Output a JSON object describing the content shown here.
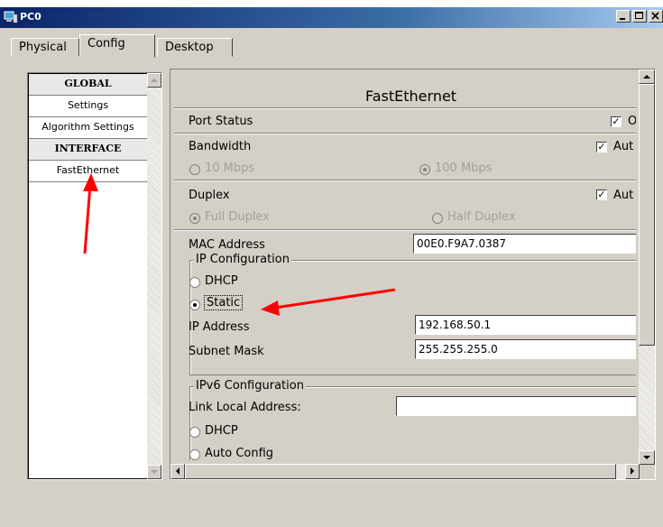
{
  "window": {
    "title": "PC0"
  },
  "tabs": [
    {
      "label": "Physical"
    },
    {
      "label": "Config"
    },
    {
      "label": "Desktop"
    }
  ],
  "sidebar": {
    "items": [
      {
        "label": "GLOBAL",
        "header": true
      },
      {
        "label": "Settings"
      },
      {
        "label": "Algorithm Settings"
      },
      {
        "label": "INTERFACE",
        "header": true
      },
      {
        "label": "FastEthernet"
      }
    ]
  },
  "panel": {
    "title": "FastEthernet",
    "port_status_label": "Port Status",
    "port_status_check_label": "O",
    "bandwidth_label": "Bandwidth",
    "bandwidth_auto_label": "Aut",
    "bw_10": "10 Mbps",
    "bw_100": "100 Mbps",
    "duplex_label": "Duplex",
    "duplex_auto_label": "Aut",
    "full_duplex": "Full Duplex",
    "half_duplex": "Half Duplex",
    "mac_label": "MAC Address",
    "mac_value": "00E0.F9A7.0387",
    "ip_config_label": "IP Configuration",
    "dhcp_label": "DHCP",
    "static_label": "Static",
    "ip_label": "IP Address",
    "ip_value": "192.168.50.1",
    "subnet_label": "Subnet Mask",
    "subnet_value": "255.255.255.0",
    "ipv6_config_label": "IPv6 Configuration",
    "link_local_label": "Link Local Address:",
    "link_local_value": "",
    "ipv6_dhcp_label": "DHCP",
    "auto_config_label": "Auto Config"
  },
  "colors": {
    "title_bar": "#0a246a",
    "annotation_arrow": "#ff0000",
    "window_bg": "#d4d0c8"
  }
}
